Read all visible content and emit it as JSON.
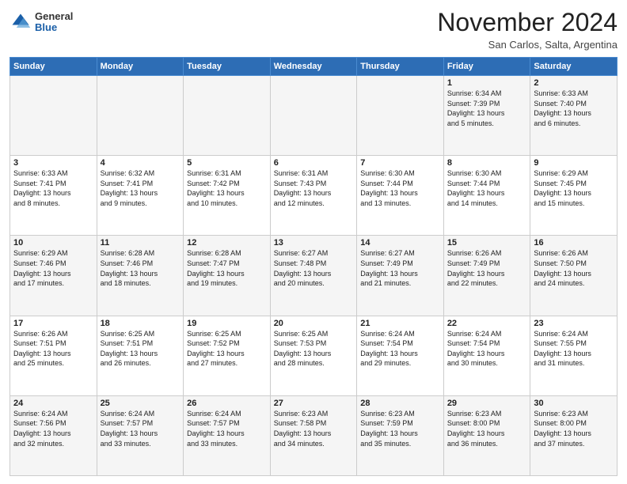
{
  "logo": {
    "general": "General",
    "blue": "Blue"
  },
  "header": {
    "month": "November 2024",
    "location": "San Carlos, Salta, Argentina"
  },
  "weekdays": [
    "Sunday",
    "Monday",
    "Tuesday",
    "Wednesday",
    "Thursday",
    "Friday",
    "Saturday"
  ],
  "weeks": [
    [
      {
        "day": "",
        "info": ""
      },
      {
        "day": "",
        "info": ""
      },
      {
        "day": "",
        "info": ""
      },
      {
        "day": "",
        "info": ""
      },
      {
        "day": "",
        "info": ""
      },
      {
        "day": "1",
        "info": "Sunrise: 6:34 AM\nSunset: 7:39 PM\nDaylight: 13 hours\nand 5 minutes."
      },
      {
        "day": "2",
        "info": "Sunrise: 6:33 AM\nSunset: 7:40 PM\nDaylight: 13 hours\nand 6 minutes."
      }
    ],
    [
      {
        "day": "3",
        "info": "Sunrise: 6:33 AM\nSunset: 7:41 PM\nDaylight: 13 hours\nand 8 minutes."
      },
      {
        "day": "4",
        "info": "Sunrise: 6:32 AM\nSunset: 7:41 PM\nDaylight: 13 hours\nand 9 minutes."
      },
      {
        "day": "5",
        "info": "Sunrise: 6:31 AM\nSunset: 7:42 PM\nDaylight: 13 hours\nand 10 minutes."
      },
      {
        "day": "6",
        "info": "Sunrise: 6:31 AM\nSunset: 7:43 PM\nDaylight: 13 hours\nand 12 minutes."
      },
      {
        "day": "7",
        "info": "Sunrise: 6:30 AM\nSunset: 7:44 PM\nDaylight: 13 hours\nand 13 minutes."
      },
      {
        "day": "8",
        "info": "Sunrise: 6:30 AM\nSunset: 7:44 PM\nDaylight: 13 hours\nand 14 minutes."
      },
      {
        "day": "9",
        "info": "Sunrise: 6:29 AM\nSunset: 7:45 PM\nDaylight: 13 hours\nand 15 minutes."
      }
    ],
    [
      {
        "day": "10",
        "info": "Sunrise: 6:29 AM\nSunset: 7:46 PM\nDaylight: 13 hours\nand 17 minutes."
      },
      {
        "day": "11",
        "info": "Sunrise: 6:28 AM\nSunset: 7:46 PM\nDaylight: 13 hours\nand 18 minutes."
      },
      {
        "day": "12",
        "info": "Sunrise: 6:28 AM\nSunset: 7:47 PM\nDaylight: 13 hours\nand 19 minutes."
      },
      {
        "day": "13",
        "info": "Sunrise: 6:27 AM\nSunset: 7:48 PM\nDaylight: 13 hours\nand 20 minutes."
      },
      {
        "day": "14",
        "info": "Sunrise: 6:27 AM\nSunset: 7:49 PM\nDaylight: 13 hours\nand 21 minutes."
      },
      {
        "day": "15",
        "info": "Sunrise: 6:26 AM\nSunset: 7:49 PM\nDaylight: 13 hours\nand 22 minutes."
      },
      {
        "day": "16",
        "info": "Sunrise: 6:26 AM\nSunset: 7:50 PM\nDaylight: 13 hours\nand 24 minutes."
      }
    ],
    [
      {
        "day": "17",
        "info": "Sunrise: 6:26 AM\nSunset: 7:51 PM\nDaylight: 13 hours\nand 25 minutes."
      },
      {
        "day": "18",
        "info": "Sunrise: 6:25 AM\nSunset: 7:51 PM\nDaylight: 13 hours\nand 26 minutes."
      },
      {
        "day": "19",
        "info": "Sunrise: 6:25 AM\nSunset: 7:52 PM\nDaylight: 13 hours\nand 27 minutes."
      },
      {
        "day": "20",
        "info": "Sunrise: 6:25 AM\nSunset: 7:53 PM\nDaylight: 13 hours\nand 28 minutes."
      },
      {
        "day": "21",
        "info": "Sunrise: 6:24 AM\nSunset: 7:54 PM\nDaylight: 13 hours\nand 29 minutes."
      },
      {
        "day": "22",
        "info": "Sunrise: 6:24 AM\nSunset: 7:54 PM\nDaylight: 13 hours\nand 30 minutes."
      },
      {
        "day": "23",
        "info": "Sunrise: 6:24 AM\nSunset: 7:55 PM\nDaylight: 13 hours\nand 31 minutes."
      }
    ],
    [
      {
        "day": "24",
        "info": "Sunrise: 6:24 AM\nSunset: 7:56 PM\nDaylight: 13 hours\nand 32 minutes."
      },
      {
        "day": "25",
        "info": "Sunrise: 6:24 AM\nSunset: 7:57 PM\nDaylight: 13 hours\nand 33 minutes."
      },
      {
        "day": "26",
        "info": "Sunrise: 6:24 AM\nSunset: 7:57 PM\nDaylight: 13 hours\nand 33 minutes."
      },
      {
        "day": "27",
        "info": "Sunrise: 6:23 AM\nSunset: 7:58 PM\nDaylight: 13 hours\nand 34 minutes."
      },
      {
        "day": "28",
        "info": "Sunrise: 6:23 AM\nSunset: 7:59 PM\nDaylight: 13 hours\nand 35 minutes."
      },
      {
        "day": "29",
        "info": "Sunrise: 6:23 AM\nSunset: 8:00 PM\nDaylight: 13 hours\nand 36 minutes."
      },
      {
        "day": "30",
        "info": "Sunrise: 6:23 AM\nSunset: 8:00 PM\nDaylight: 13 hours\nand 37 minutes."
      }
    ]
  ]
}
